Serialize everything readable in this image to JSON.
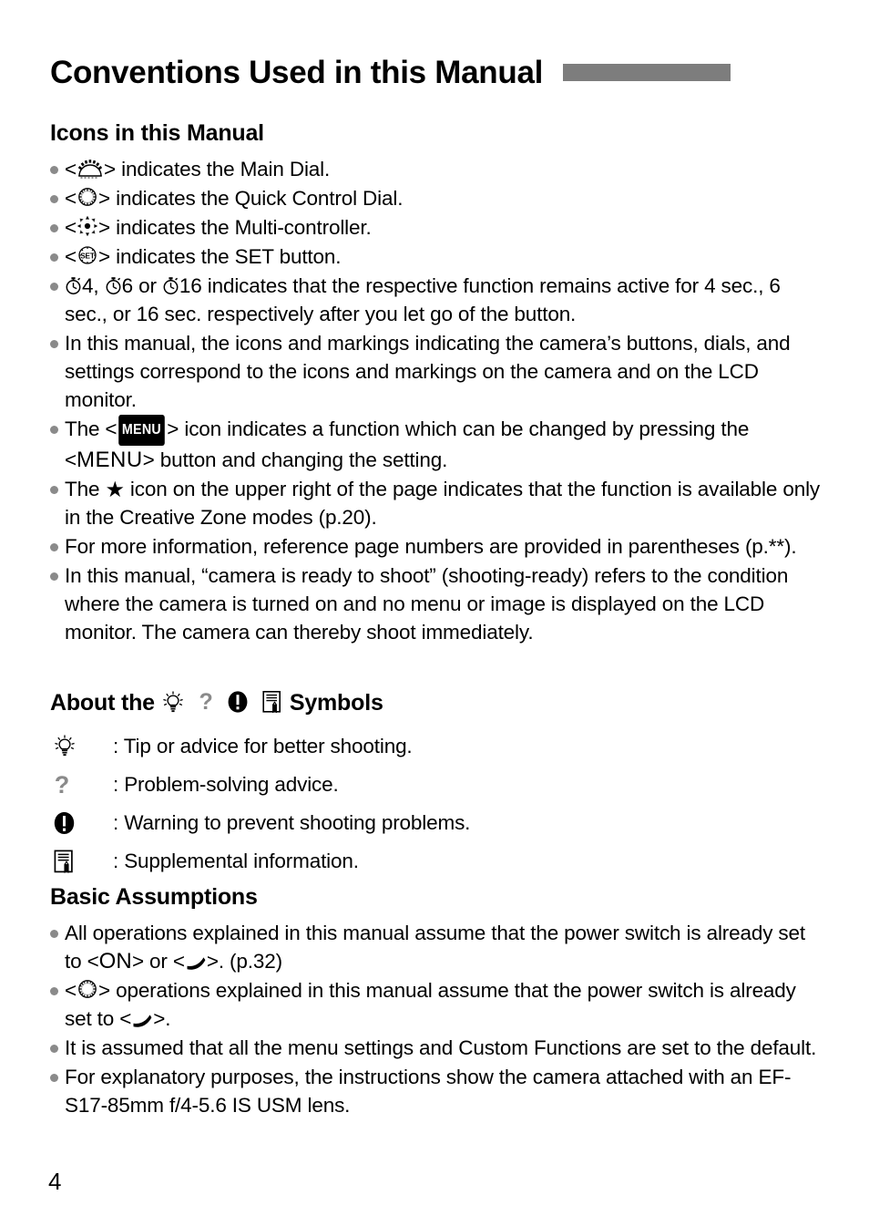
{
  "document": {
    "title": "Conventions Used in this Manual",
    "page_number": "4",
    "accent_bar_color": "#7d7d7d",
    "bullet_color": "#8a8a8a"
  },
  "sections": [
    {
      "heading": "Icons in this Manual",
      "items": [
        {
          "id": "main-dial",
          "icon": "main-dial-icon",
          "prefix": "<",
          "suffix": ">",
          "text": " indicates the Main Dial."
        },
        {
          "id": "quick-control-dial",
          "icon": "quick-control-dial-icon",
          "prefix": "<",
          "suffix": ">",
          "text": " indicates the Quick Control Dial."
        },
        {
          "id": "multi-controller",
          "icon": "multi-controller-icon",
          "prefix": "<",
          "suffix": ">",
          "text": " indicates the Multi-controller."
        },
        {
          "id": "set-button",
          "icon": "set-button-icon",
          "prefix": "<",
          "suffix": ">",
          "text": " indicates the SET button."
        },
        {
          "id": "timers",
          "timer_values": [
            "4",
            "6",
            "16"
          ],
          "separator_1": ",",
          "separator_2": "or",
          "text": " indicates that the respective function remains active for 4 sec., 6 sec., or 16 sec. respectively after you let go of the button."
        },
        {
          "id": "icons-markings",
          "text": "In this manual, the icons and markings indicating the camera’s buttons, dials, and settings correspond to the icons and markings on the camera and on the LCD monitor."
        },
        {
          "id": "menu-icon",
          "lead": "The <",
          "menu_badge": "MENU",
          "mid": "> icon indicates a function which can be changed by pressing the <",
          "menu_word": "MENU",
          "tail": "> button and changing the setting."
        },
        {
          "id": "star-icon",
          "lead": "The ",
          "star": "★",
          "tail": " icon on the upper right of the page indicates that the function is available only in the Creative Zone modes (p.20)."
        },
        {
          "id": "reference-pages",
          "text": "For more information, reference page numbers are provided in parentheses (p.**)."
        },
        {
          "id": "shooting-ready",
          "text": "In this manual, “camera is ready to shoot” (shooting-ready) refers to the condition where the camera is turned on and no menu or image is displayed on the LCD monitor. The camera can thereby shoot immediately."
        }
      ]
    },
    {
      "heading_prefix": "About the",
      "heading_suffix": "Symbols",
      "heading_icons": [
        "tip-bulb-icon",
        "question-mark-icon",
        "warning-icon",
        "note-icon"
      ],
      "definitions": [
        {
          "icon": "tip-bulb-icon",
          "text": ": Tip or advice for better shooting."
        },
        {
          "icon": "question-mark-icon",
          "text": ": Problem-solving advice."
        },
        {
          "icon": "warning-icon",
          "text": ": Warning to prevent shooting problems."
        },
        {
          "icon": "note-icon",
          "text": ": Supplemental information."
        }
      ]
    },
    {
      "heading": "Basic Assumptions",
      "items": [
        {
          "id": "power-switch-on",
          "lead": "All operations explained in this manual assume that the power switch is already set to <",
          "on_word": "ON",
          "mid": "> or <",
          "power_glyph": "power-hook-icon",
          "tail": ">. (p.32)"
        },
        {
          "id": "quick-control-dial-assumption",
          "prefix": "<",
          "icon": "quick-control-dial-icon",
          "mid": "> operations explained in this manual assume that the power switch is already set to <",
          "power_glyph": "power-hook-icon",
          "tail": ">."
        },
        {
          "id": "defaults",
          "text": "It is assumed that all the menu settings and Custom Functions are set to the default."
        },
        {
          "id": "lens",
          "text": "For explanatory purposes, the instructions show the camera attached with an EF-S17-85mm f/4-5.6 IS USM lens."
        }
      ]
    }
  ]
}
